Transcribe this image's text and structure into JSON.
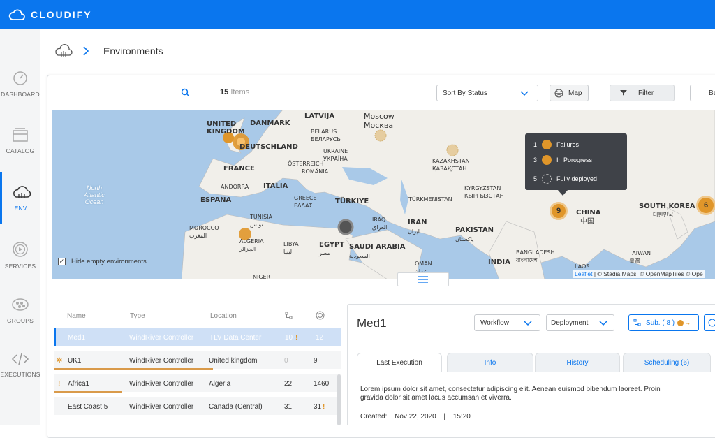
{
  "brand": {
    "name": "CLOUDIFY"
  },
  "sidebar": {
    "items": [
      {
        "label": "DASHBOARD",
        "icon": "dashboard-icon"
      },
      {
        "label": "CATALOG",
        "icon": "catalog-icon"
      },
      {
        "label": "ENV.",
        "icon": "cloud-icon",
        "active": true
      },
      {
        "label": "SERVICES",
        "icon": "play-icon"
      },
      {
        "label": "GROUPS",
        "icon": "groups-icon"
      },
      {
        "label": "EXECUTIONS",
        "icon": "code-icon"
      }
    ]
  },
  "header": {
    "title": "Environments"
  },
  "toolbar": {
    "search_placeholder": "",
    "count_number": "15",
    "count_label": "Items",
    "sort_label": "Sort By Status",
    "map_label": "Map",
    "filter_label": "Filter",
    "extra_label": "Ba"
  },
  "map": {
    "countries": {
      "uk": [
        "UNITED",
        "KINGDOM"
      ],
      "denmark": "DANMARK",
      "latvia": "LATVIJA",
      "moscow": "Moscow",
      "moscow_local": "Москва",
      "belarus": "BELARUS",
      "belarus_local": "БЕЛАРУСЬ",
      "germany": "DEUTSCHLAND",
      "ukraine": "UKRAINE",
      "ukraine_local": "УКРАЇНА",
      "austria": "ÖSTERREICH",
      "france": "FRANCE",
      "romania": "ROMÂNIA",
      "andorra": "ANDORRA",
      "italy": "ITALIA",
      "spain": "ESPAÑA",
      "greece": "ΕΛΛΑΣ",
      "greece_latin": "GREECE",
      "turkey": "TÜRKIYE",
      "kazakhstan": "KAZAKHSTAN",
      "kazakhstan_local": "ҚАЗАҚСТАН",
      "kyrgyzstan": "KYRGYZSTAN",
      "kyrgyzstan_local": "КЫРГЫЗСТАН",
      "turkmenistan": "TÜRKMENISTAN",
      "tunisia": "TUNISIA",
      "tunisia_local": "تونس",
      "morocco": "MOROCCO",
      "morocco_local": "المغرب",
      "algeria": "ALGERIA",
      "algeria_local": "الجزائر",
      "libya": "LIBYA",
      "libya_local": "ليبيا",
      "egypt": "EGYPT",
      "egypt_local": "مصر",
      "iraq": "IRAQ",
      "iraq_local": "العراق",
      "iran": "IRAN",
      "iran_local": "ایران",
      "saudi": "SAUDI ARABIA",
      "saudi_local": "السعودية",
      "pakistan": "PAKISTAN",
      "pakistan_local": "پاکستان",
      "oman": "OMAN",
      "oman_local": "عمان",
      "india": "INDIA",
      "china": "CHINA",
      "china_local": "中国",
      "korea": "SOUTH KOREA",
      "korea_local": "대한민국",
      "bangladesh": "BANGLADESH",
      "bangladesh_local": "বাংলাদেশ",
      "taiwan": "TAIWAN",
      "taiwan_local": "臺灣",
      "laos": "LAOS",
      "niger": "NIGER"
    },
    "ocean": "North Atlantic Ocean",
    "cluster_china": "9",
    "cluster_korea": "6",
    "legend": [
      {
        "count": "1",
        "label": "Failures"
      },
      {
        "count": "3",
        "label": "In Porogress"
      },
      {
        "count": "5",
        "label": "Fully deployed"
      }
    ],
    "attribution_leaflet": "Leaflet",
    "attribution_rest": "| © Stadia Maps, © OpenMapTiles © Ope",
    "hide_empty_label": "Hide empty environments",
    "colors": {
      "water": "#a9c9e8",
      "land": "#f1efea",
      "marker": "#e0962a"
    }
  },
  "table": {
    "headers": [
      "Name",
      "Type",
      "Location"
    ],
    "rows": [
      {
        "name": "Med1",
        "type": "WindRiver Controller",
        "location": "TLV Data Center",
        "c1": "10",
        "c2": "12",
        "selected": true
      },
      {
        "name": "UK1",
        "type": "WindRiver Controller",
        "location": "United kingdom",
        "c1": "0",
        "c2": "9"
      },
      {
        "name": "Africa1",
        "type": "WindRiver Controller",
        "location": "Algeria",
        "c1": "22",
        "c2": "1460"
      },
      {
        "name": "East Coast 5",
        "type": "WindRiver Controller",
        "location": "Canada (Central)",
        "c1": "31",
        "c2": "31"
      }
    ]
  },
  "detail": {
    "title": "Med1",
    "workflow_label": "Workflow",
    "deployment_label": "Deployment",
    "sub_label": "Sub. ( 8 )",
    "tabs": [
      "Last Execution",
      "Info",
      "History",
      "Scheduling (6)"
    ],
    "description": "Lorem ipsum dolor sit amet, consectetur adipiscing elit. Aenean euismod bibendum laoreet. Proin gravida dolor sit amet lacus accumsan et viverra.",
    "created_label": "Created:",
    "created_date": "Nov 22, 2020",
    "created_sep": "|",
    "created_time": "15:20"
  }
}
